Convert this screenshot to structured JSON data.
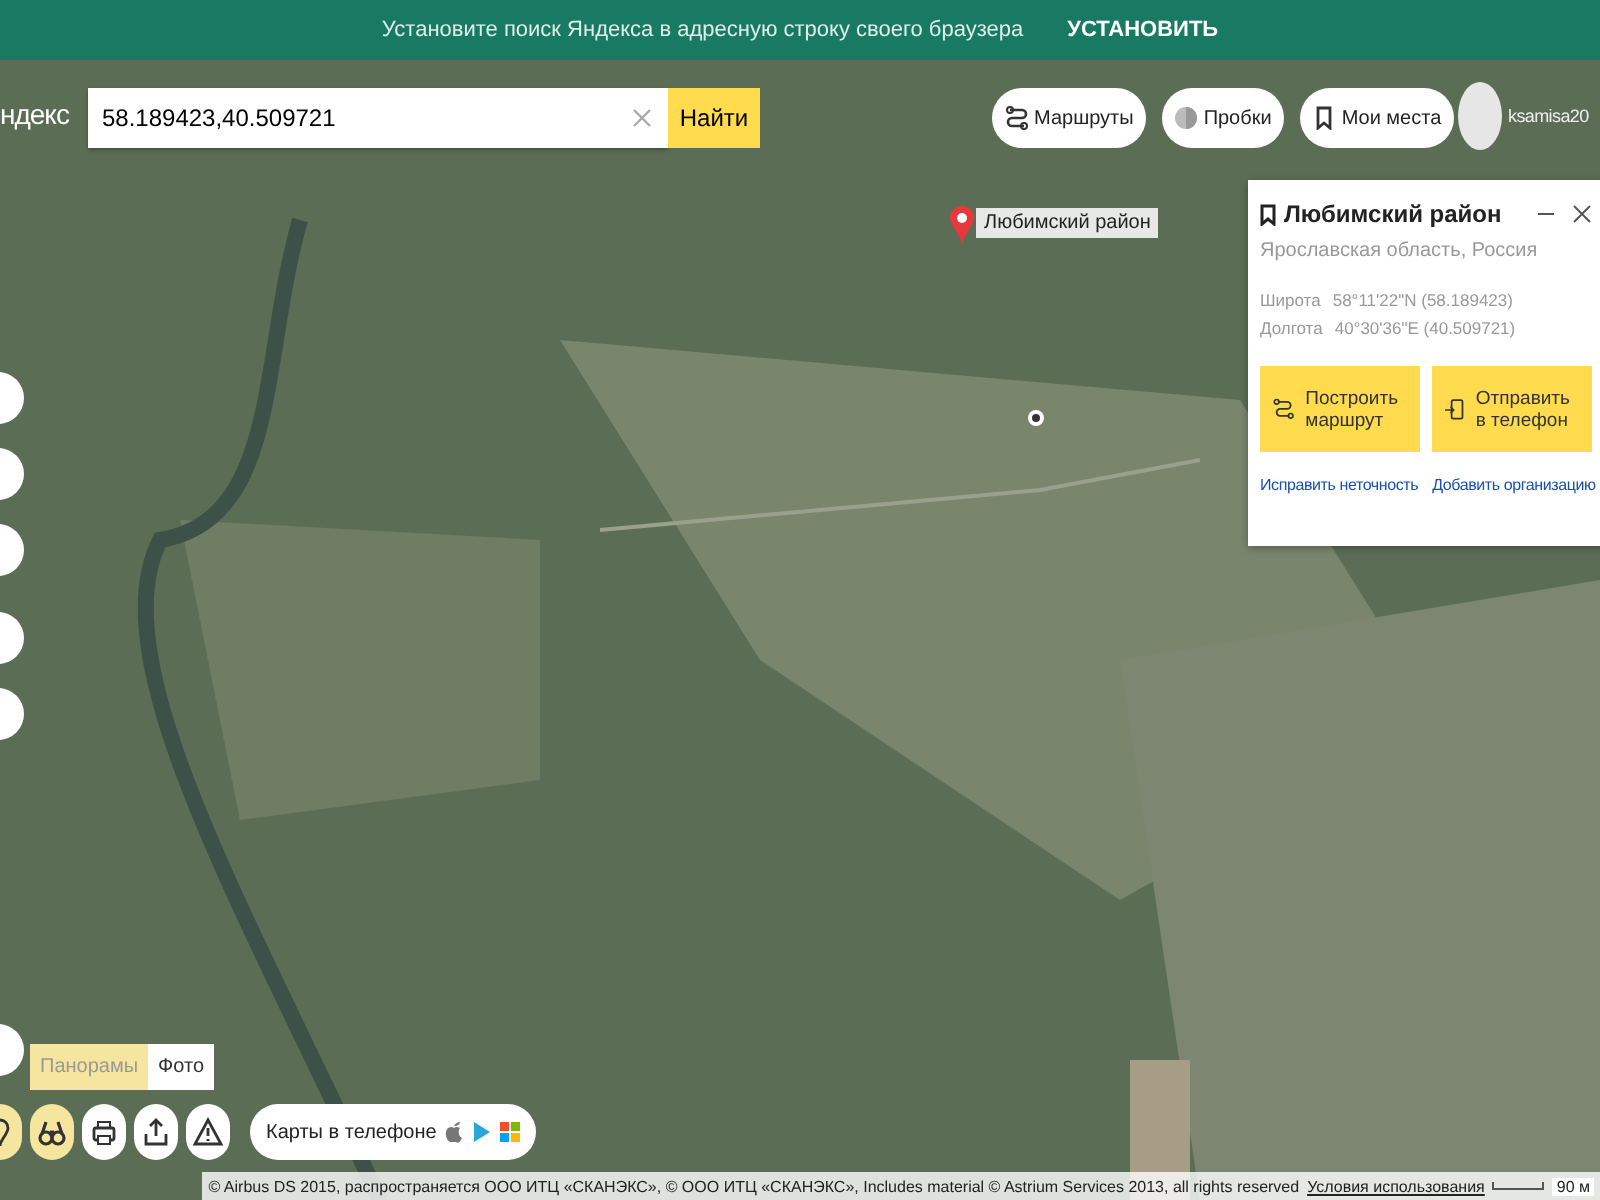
{
  "banner": {
    "text": "Установите поиск Яндекса в адресную строку своего браузера",
    "action": "УСТАНОВИТЬ"
  },
  "header": {
    "logo": "ндекс",
    "search": {
      "value": "58.189423,40.509721"
    },
    "search_button": "Найти",
    "nav": [
      {
        "kind": "routes",
        "label": "Маршруты"
      },
      {
        "kind": "traffic",
        "label": "Пробки"
      },
      {
        "kind": "places",
        "label": "Мои места"
      }
    ],
    "user": "ksamisa20"
  },
  "marker": {
    "label": "Любимский район"
  },
  "card": {
    "title": "Любимский район",
    "subtitle": "Ярославская область, Россия",
    "coords": [
      {
        "label": "Широта",
        "value": "58°11'22\"N (58.189423)"
      },
      {
        "label": "Долгота",
        "value": "40°30'36\"E (40.509721)"
      }
    ],
    "actions": [
      {
        "kind": "route",
        "label": "Построить маршрут"
      },
      {
        "kind": "phone",
        "label": "Отправить в телефон"
      }
    ],
    "links": [
      "Исправить неточность",
      "Добавить организацию"
    ]
  },
  "layer_tabs": [
    {
      "label": "Панорамы",
      "selected": true
    },
    {
      "label": "Фото",
      "selected": false
    }
  ],
  "tools": [
    {
      "kind": "pin",
      "active": true
    },
    {
      "kind": "binoculars",
      "active": true
    },
    {
      "kind": "print",
      "active": false
    },
    {
      "kind": "share",
      "active": false
    },
    {
      "kind": "warning",
      "active": false
    }
  ],
  "phone_promo": {
    "label": "Карты в телефоне"
  },
  "footer": {
    "attribution": "© Airbus DS 2015, распространяется ООО ИТЦ «СКАНЭКС», © ООО ИТЦ «СКАНЭКС», Includes material © Astrium Services 2013, all rights reserved",
    "terms": "Условия использования",
    "scale": "90 м"
  }
}
